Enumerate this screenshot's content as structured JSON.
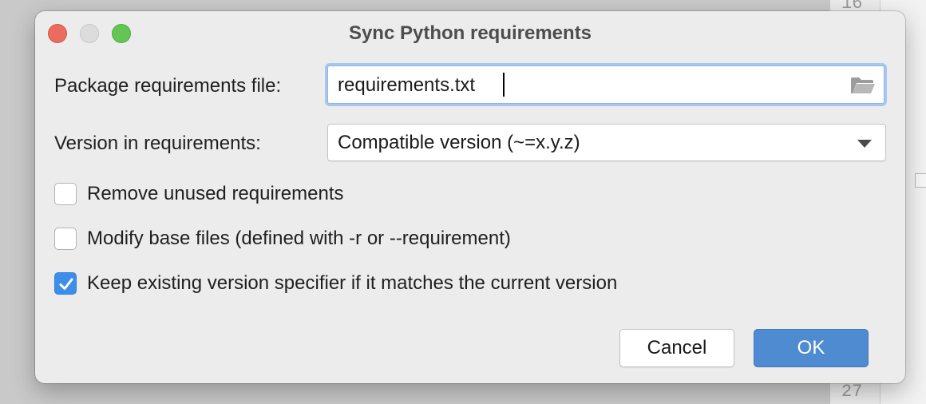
{
  "background": {
    "line_number_top": "16",
    "line_number_bottom": "27"
  },
  "dialog": {
    "title": "Sync Python requirements",
    "requirements_file": {
      "label": "Package requirements file:",
      "value": "requirements.txt",
      "browse_icon": "folder-open-icon"
    },
    "version": {
      "label": "Version in requirements:",
      "selected": "Compatible version (~=x.y.z)"
    },
    "options": [
      {
        "label": "Remove unused requirements",
        "checked": false
      },
      {
        "label": "Modify base files (defined with -r or --requirement)",
        "checked": false
      },
      {
        "label": "Keep existing version specifier if it matches the current version",
        "checked": true
      }
    ],
    "buttons": {
      "cancel": "Cancel",
      "ok": "OK"
    }
  },
  "colors": {
    "accent": "#3d8ee8",
    "ok_button": "#4f8bd1",
    "focus_ring": "#a7c7ef",
    "close": "#ed6a5e",
    "minimize": "#dcdcdc",
    "maximize": "#62c554"
  }
}
